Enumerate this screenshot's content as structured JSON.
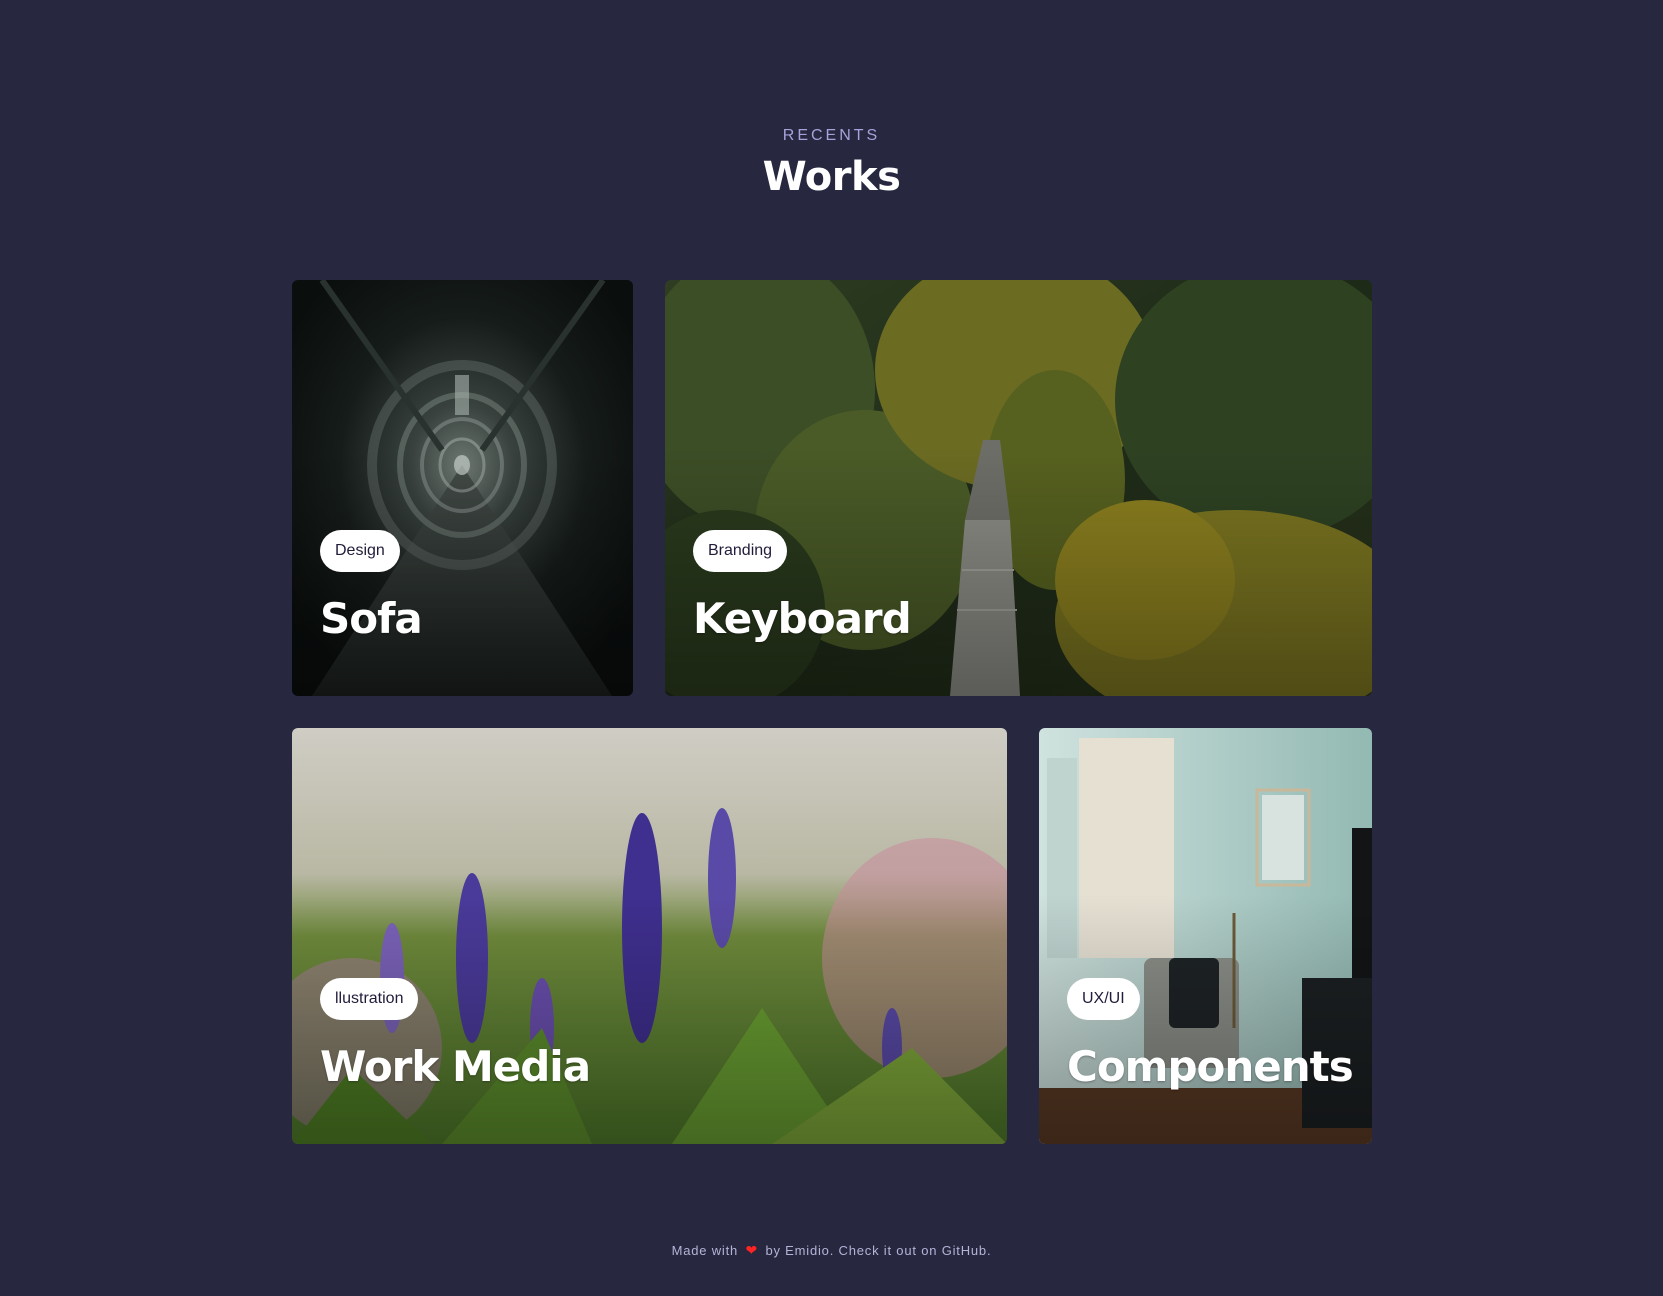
{
  "header": {
    "eyebrow": "RECENTS",
    "title": "Works"
  },
  "cards": [
    {
      "tag": "Design",
      "title": "Sofa",
      "scene": "tunnel-photo"
    },
    {
      "tag": "Branding",
      "title": "Keyboard",
      "scene": "forest-photo"
    },
    {
      "tag": "llustration",
      "title": "Work Media",
      "scene": "lupine-flowers-photo"
    },
    {
      "tag": "UX/UI",
      "title": "Components",
      "scene": "room-chair-photo"
    }
  ],
  "footer": {
    "made_with": "Made with",
    "heart": "❤",
    "by": "by Emidio. Check it out on",
    "link": "GitHub",
    "end": "."
  },
  "colors": {
    "background": "#272740",
    "eyebrow": "#a7a2d9",
    "heart": "#ff2424",
    "tag_bg": "#ffffff",
    "tag_text": "#1f1d3a"
  }
}
